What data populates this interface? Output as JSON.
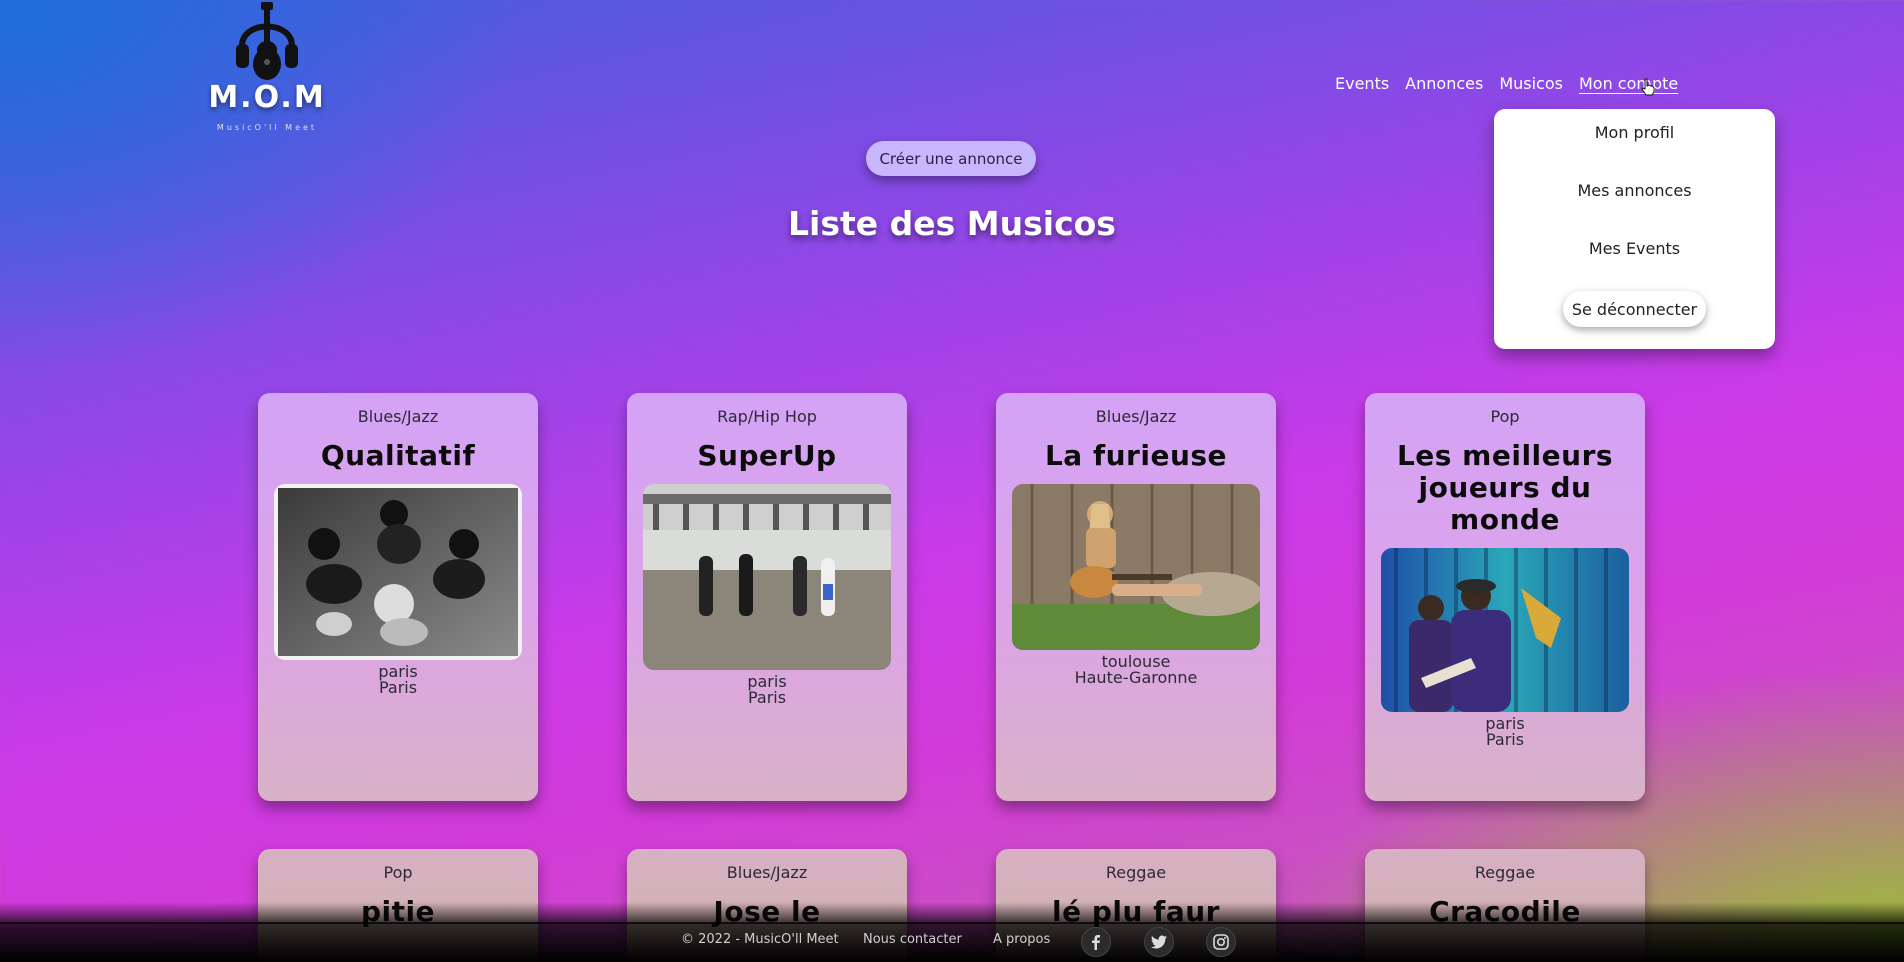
{
  "logo": {
    "text": "M.O.M",
    "tagline": "MusicO'll Meet"
  },
  "nav": [
    {
      "label": "Events"
    },
    {
      "label": "Annonces"
    },
    {
      "label": "Musicos"
    },
    {
      "label": "Mon compte",
      "active": true
    }
  ],
  "create_button": "Créer une annonce",
  "page_title": "Liste des Musicos",
  "dropdown": {
    "items": [
      "Mon profil",
      "Mes annonces",
      "Mes Events"
    ],
    "logout": "Se déconnecter"
  },
  "cards": [
    {
      "genre": "Blues/Jazz",
      "title": "Qualitatif",
      "city": "paris",
      "region": "Paris",
      "photo": "band-black-and-white"
    },
    {
      "genre": "Rap/Hip Hop",
      "title": "SuperUp",
      "city": "paris",
      "region": "Paris",
      "photo": "band-on-beach"
    },
    {
      "genre": "Blues/Jazz",
      "title": "La furieuse",
      "city": "toulouse",
      "region": "Haute-Garonne",
      "photo": "woman-with-guitar"
    },
    {
      "genre": "Pop",
      "title": "Les meilleurs joueurs du monde",
      "city": "paris",
      "region": "Paris",
      "photo": "saxophone-on-stage"
    },
    {
      "genre": "Pop",
      "title": "pitie",
      "city": "",
      "region": ""
    },
    {
      "genre": "Blues/Jazz",
      "title": "Jose le",
      "city": "",
      "region": ""
    },
    {
      "genre": "Reggae",
      "title": "lé plu faur",
      "city": "",
      "region": ""
    },
    {
      "genre": "Reggae",
      "title": "Cracodile",
      "city": "",
      "region": ""
    }
  ],
  "footer": {
    "copyright": "© 2022 - MusicO'll Meet",
    "contact": "Nous contacter",
    "about": "A propos",
    "socials": [
      "facebook-icon",
      "twitter-icon",
      "instagram-icon"
    ]
  }
}
